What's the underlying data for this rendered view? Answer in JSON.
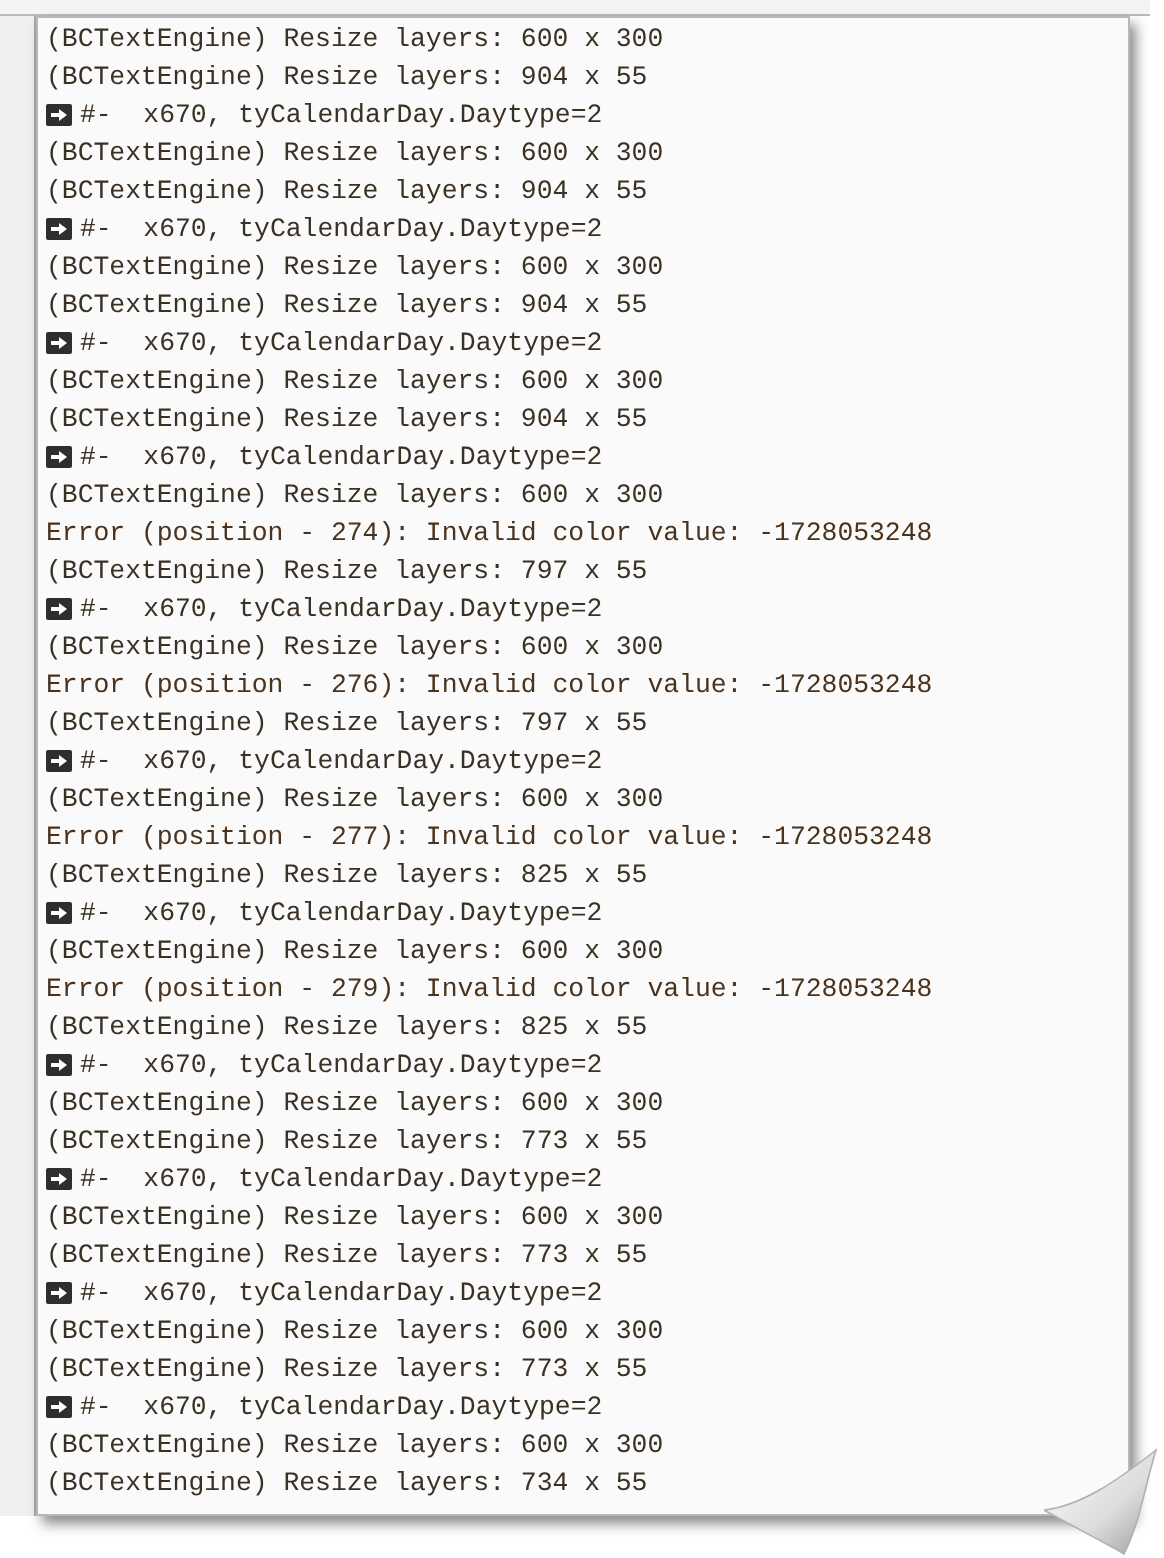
{
  "log": {
    "lines": [
      {
        "kind": "info",
        "text": "(BCTextEngine) Resize layers: 600 x 300"
      },
      {
        "kind": "info",
        "text": "(BCTextEngine) Resize layers: 904 x 55"
      },
      {
        "kind": "arrow",
        "text": "#-  x670, tyCalendarDay.Daytype=2"
      },
      {
        "kind": "info",
        "text": "(BCTextEngine) Resize layers: 600 x 300"
      },
      {
        "kind": "info",
        "text": "(BCTextEngine) Resize layers: 904 x 55"
      },
      {
        "kind": "arrow",
        "text": "#-  x670, tyCalendarDay.Daytype=2"
      },
      {
        "kind": "info",
        "text": "(BCTextEngine) Resize layers: 600 x 300"
      },
      {
        "kind": "info",
        "text": "(BCTextEngine) Resize layers: 904 x 55"
      },
      {
        "kind": "arrow",
        "text": "#-  x670, tyCalendarDay.Daytype=2"
      },
      {
        "kind": "info",
        "text": "(BCTextEngine) Resize layers: 600 x 300"
      },
      {
        "kind": "info",
        "text": "(BCTextEngine) Resize layers: 904 x 55"
      },
      {
        "kind": "arrow",
        "text": "#-  x670, tyCalendarDay.Daytype=2"
      },
      {
        "kind": "info",
        "text": "(BCTextEngine) Resize layers: 600 x 300"
      },
      {
        "kind": "error",
        "text": "Error (position - 274): Invalid color value: -1728053248"
      },
      {
        "kind": "info",
        "text": "(BCTextEngine) Resize layers: 797 x 55"
      },
      {
        "kind": "arrow",
        "text": "#-  x670, tyCalendarDay.Daytype=2"
      },
      {
        "kind": "info",
        "text": "(BCTextEngine) Resize layers: 600 x 300"
      },
      {
        "kind": "error",
        "text": "Error (position - 276): Invalid color value: -1728053248"
      },
      {
        "kind": "info",
        "text": "(BCTextEngine) Resize layers: 797 x 55"
      },
      {
        "kind": "arrow",
        "text": "#-  x670, tyCalendarDay.Daytype=2"
      },
      {
        "kind": "info",
        "text": "(BCTextEngine) Resize layers: 600 x 300"
      },
      {
        "kind": "error",
        "text": "Error (position - 277): Invalid color value: -1728053248"
      },
      {
        "kind": "info",
        "text": "(BCTextEngine) Resize layers: 825 x 55"
      },
      {
        "kind": "arrow",
        "text": "#-  x670, tyCalendarDay.Daytype=2"
      },
      {
        "kind": "info",
        "text": "(BCTextEngine) Resize layers: 600 x 300"
      },
      {
        "kind": "error",
        "text": "Error (position - 279): Invalid color value: -1728053248"
      },
      {
        "kind": "info",
        "text": "(BCTextEngine) Resize layers: 825 x 55"
      },
      {
        "kind": "arrow",
        "text": "#-  x670, tyCalendarDay.Daytype=2"
      },
      {
        "kind": "info",
        "text": "(BCTextEngine) Resize layers: 600 x 300"
      },
      {
        "kind": "info",
        "text": "(BCTextEngine) Resize layers: 773 x 55"
      },
      {
        "kind": "arrow",
        "text": "#-  x670, tyCalendarDay.Daytype=2"
      },
      {
        "kind": "info",
        "text": "(BCTextEngine) Resize layers: 600 x 300"
      },
      {
        "kind": "info",
        "text": "(BCTextEngine) Resize layers: 773 x 55"
      },
      {
        "kind": "arrow",
        "text": "#-  x670, tyCalendarDay.Daytype=2"
      },
      {
        "kind": "info",
        "text": "(BCTextEngine) Resize layers: 600 x 300"
      },
      {
        "kind": "info",
        "text": "(BCTextEngine) Resize layers: 773 x 55"
      },
      {
        "kind": "arrow",
        "text": "#-  x670, tyCalendarDay.Daytype=2"
      },
      {
        "kind": "info",
        "text": "(BCTextEngine) Resize layers: 600 x 300"
      },
      {
        "kind": "info",
        "text": "(BCTextEngine) Resize layers: 734 x 55"
      }
    ]
  }
}
